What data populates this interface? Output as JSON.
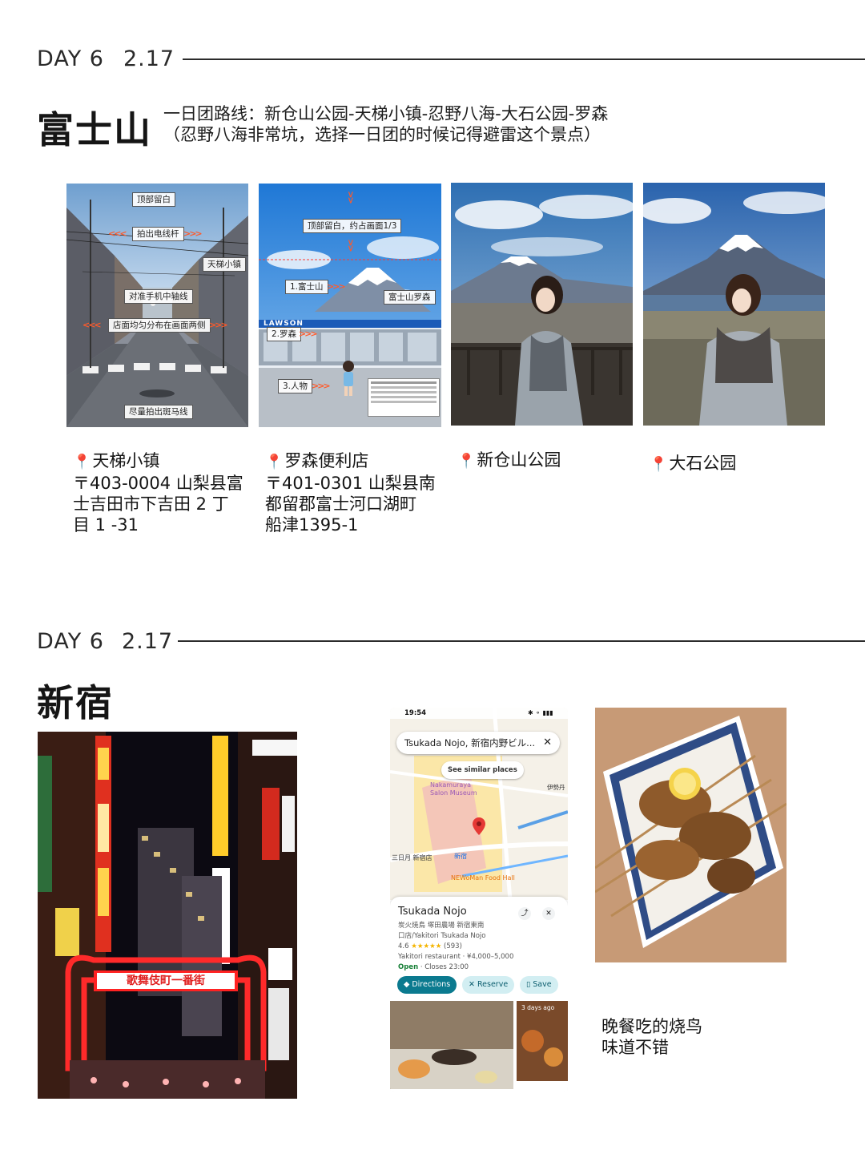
{
  "section1": {
    "day_label": "DAY 6",
    "date_label": "2.17",
    "city": "富士山",
    "route_line1": "一日团路线：新仓山公园-天梯小镇-忍野八海-大石公园-罗森",
    "route_line2": "（忍野八海非常坑，选择一日团的时候记得避雷这个景点）",
    "photo1_annotations": {
      "top_blank": "顶部留白",
      "power_lines": "拍出电线杆",
      "town": "天梯小镇",
      "center_axis": "对准手机中轴线",
      "shops": "店面均匀分布在画面两侧",
      "crosswalk": "尽量拍出斑马线"
    },
    "photo2_annotations": {
      "top_blank": "顶部留白，约占画面1/3",
      "fuji": "1.富士山",
      "fuji_lawson": "富士山罗森",
      "lawson": "2.罗森",
      "person": "3.人物",
      "lawson_sign": "LAWSON"
    },
    "places": [
      {
        "name": "天梯小镇",
        "address_lines": [
          "〒403-0004 山梨县富",
          "士吉田市下吉田 2 丁",
          "目 1 -31"
        ]
      },
      {
        "name": "罗森便利店",
        "address_lines": [
          "〒401-0301 山梨县南",
          "都留郡富士河口湖町",
          "船津1395-1"
        ]
      },
      {
        "name": "新仓山公园",
        "address_lines": []
      },
      {
        "name": "大石公园",
        "address_lines": []
      }
    ],
    "pin_icon": "map-pin-icon"
  },
  "section2": {
    "day_label": "DAY 6",
    "date_label": "2.17",
    "city": "新宿",
    "kabukicho_sign": "歌舞伎町一番街",
    "map": {
      "status_time": "19:54",
      "search_text": "Tsukada Nojo, 新宿内野ビル...",
      "see_similar": "See similar places",
      "museum_label": "Nakamuraya Salon Museum",
      "station_label": "新宿",
      "mitsuki_label": "三日月 新宿店",
      "food_hall": "NEWoMan Food Hall",
      "isetan": "伊勢丹",
      "place_title": "Tsukada Nojo",
      "place_jp": "炭火焼鳥 塚田農場 新宿東南",
      "place_jp2": "口店/Yakitori Tsukada Nojo",
      "rating": "4.6",
      "stars": "★★★★★",
      "reviews": "(593)",
      "category": "Yakitori restaurant · ",
      "price": "¥4,000–5,000",
      "open": "Open",
      "closes": " · Closes 23:00",
      "btn_directions": "Directions",
      "btn_reserve": "Reserve",
      "btn_save": "Save",
      "photo_badge": "3 days ago"
    },
    "dinner_line1": "晚餐吃的烧鸟",
    "dinner_line2": "味道不错"
  }
}
